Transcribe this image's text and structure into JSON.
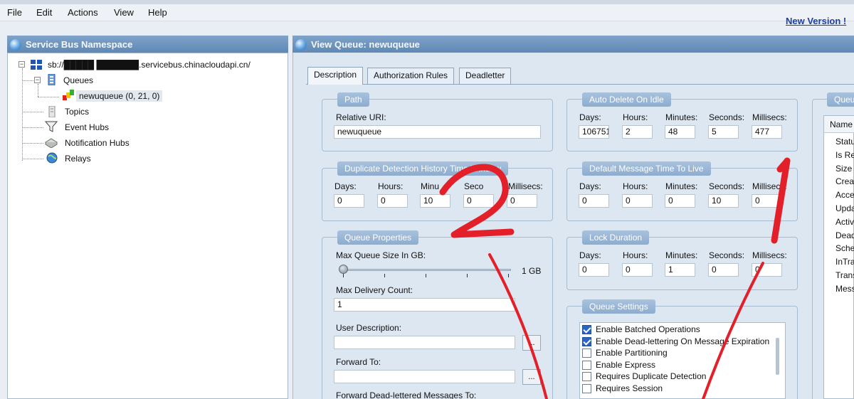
{
  "menu": [
    "File",
    "Edit",
    "Actions",
    "View",
    "Help"
  ],
  "new_version": "New Version !",
  "left_panel": {
    "title": "Service Bus Namespace",
    "root": "sb://█████ ███████.servicebus.chinacloudapi.cn/",
    "items": {
      "queues": "Queues",
      "queue": "newuqueue (0, 21, 0)",
      "topics": "Topics",
      "event_hubs": "Event Hubs",
      "notification_hubs": "Notification Hubs",
      "relays": "Relays"
    }
  },
  "right_panel": {
    "title": "View Queue: newuqueue",
    "tabs": [
      "Description",
      "Authorization Rules",
      "Deadletter"
    ],
    "path": {
      "title": "Path",
      "relative_uri_label": "Relative URI:",
      "relative_uri": "newuqueue"
    },
    "time_labels": {
      "days": "Days:",
      "hours": "Hours:",
      "minutes": "Minutes:",
      "seconds": "Seconds:",
      "millisecs": "Millisecs:"
    },
    "duplicate_detection": {
      "title": "Duplicate Detection History Time Window",
      "minutes_label": "Minu",
      "seconds_label": "Seco",
      "values": [
        "0",
        "0",
        "10",
        "0",
        "0"
      ]
    },
    "auto_delete": {
      "title": "Auto Delete On Idle",
      "values": [
        "106751",
        "2",
        "48",
        "5",
        "477"
      ]
    },
    "default_ttl": {
      "title": "Default Message Time To Live",
      "values": [
        "0",
        "0",
        "0",
        "10",
        "0"
      ]
    },
    "lock_duration": {
      "title": "Lock Duration",
      "values": [
        "0",
        "0",
        "1",
        "0",
        "0"
      ]
    },
    "queue_properties": {
      "title": "Queue Properties",
      "max_size_label": "Max Queue Size In GB:",
      "max_size_value": "1 GB",
      "max_size_level": 0.0,
      "max_delivery_label": "Max Delivery Count:",
      "max_delivery_value": "1",
      "user_desc_label": "User Description:",
      "forward_to_label": "Forward To:",
      "forward_dlq_label": "Forward Dead-lettered Messages To:",
      "browse": "..."
    },
    "queue_settings": {
      "title": "Queue Settings",
      "items": [
        {
          "label": "Enable Batched Operations",
          "checked": true
        },
        {
          "label": "Enable Dead-lettering On Message Expiration",
          "checked": true
        },
        {
          "label": "Enable Partitioning",
          "checked": false
        },
        {
          "label": "Enable Express",
          "checked": false
        },
        {
          "label": "Requires Duplicate Detection",
          "checked": false
        },
        {
          "label": "Requires Session",
          "checked": false
        }
      ]
    },
    "queue_info": {
      "title": "Queu",
      "column": "Name",
      "rows": [
        "Statu",
        "Is Re",
        "Size I",
        "Creat",
        "Acce",
        "Upda",
        "Activ",
        "Dead",
        "Sche",
        "InTra",
        "Trans",
        "Mess"
      ]
    }
  },
  "annotations": {
    "marker_2": "2",
    "marker_1": "1",
    "color": "#e3202a"
  }
}
